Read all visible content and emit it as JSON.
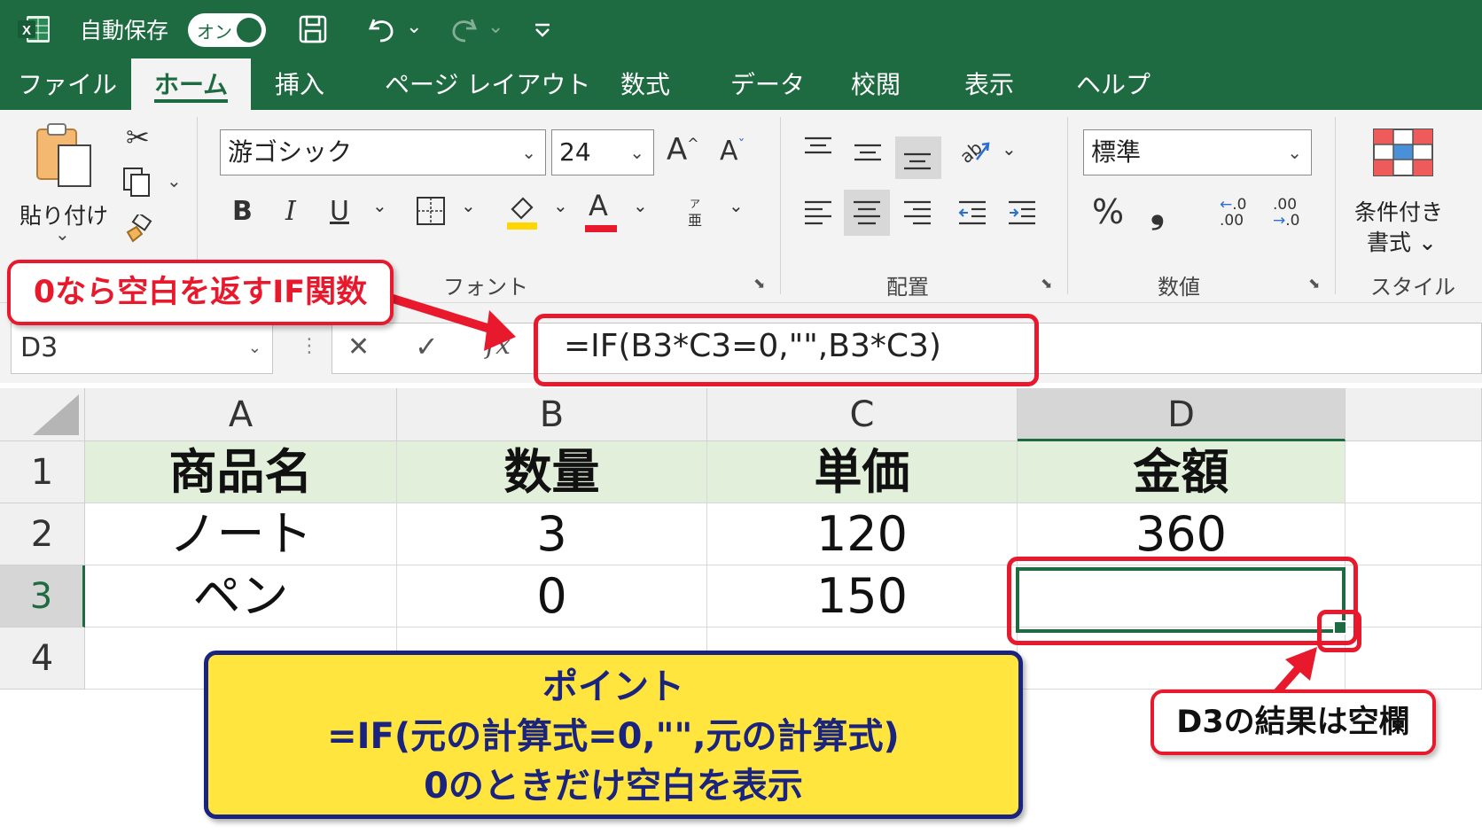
{
  "titlebar": {
    "app_icon_letter": "X",
    "autosave_label": "自動保存",
    "autosave_toggle": "オン",
    "save_icon": "save-icon",
    "undo_icon": "undo-icon",
    "redo_icon": "redo-icon",
    "customize_icon": "customize-quick-access-icon"
  },
  "tabs": [
    "ファイル",
    "ホーム",
    "挿入",
    "ページ レイアウト",
    "数式",
    "データ",
    "校閲",
    "表示",
    "ヘルプ"
  ],
  "active_tab": "ホーム",
  "ribbon": {
    "clipboard": {
      "paste_label": "貼り付け",
      "paste_caret": "⌄"
    },
    "font": {
      "font_name": "游ゴシック",
      "font_size": "24",
      "grow_font": "A",
      "shrink_font": "A",
      "bold": "B",
      "italic": "I",
      "underline": "U",
      "font_color": "A",
      "group_label": "フォント"
    },
    "alignment": {
      "group_label": "配置"
    },
    "number": {
      "format": "標準",
      "percent": "%",
      "comma": "❟",
      "inc_decimal": "←.0\n.00",
      "dec_decimal": ".00\n→.0",
      "group_label": "数値"
    },
    "styles": {
      "conditional_label_1": "条件付き",
      "conditional_label_2": "書式 ⌄",
      "group_label": "スタイル"
    }
  },
  "formula_bar": {
    "name_box": "D3",
    "cancel": "✕",
    "enter": "✓",
    "fx": "fx",
    "formula": "=IF(B3*C3=0,\"\",B3*C3)"
  },
  "grid": {
    "columns": [
      "A",
      "B",
      "C",
      "D"
    ],
    "rows": [
      "1",
      "2",
      "3",
      "4"
    ],
    "cells": [
      [
        "商品名",
        "数量",
        "単価",
        "金額"
      ],
      [
        "ノート",
        "3",
        "120",
        "360"
      ],
      [
        "ペン",
        "0",
        "150",
        ""
      ],
      [
        "",
        "",
        "",
        ""
      ]
    ],
    "selected_cell": "D3"
  },
  "callouts": {
    "if_label": "0なら空白を返すIF関数",
    "d3_label": "D3の結果は空欄",
    "point_title": "ポイント",
    "point_formula": "=IF(元の計算式=0,\"\",元の計算式)",
    "point_desc": "0のときだけ空白を表示"
  },
  "colors": {
    "excel_green": "#1e6b41",
    "header_fill": "#e2efda",
    "callout_red": "#e8192c",
    "point_yellow": "#ffe53d",
    "point_navy": "#1a237e"
  }
}
